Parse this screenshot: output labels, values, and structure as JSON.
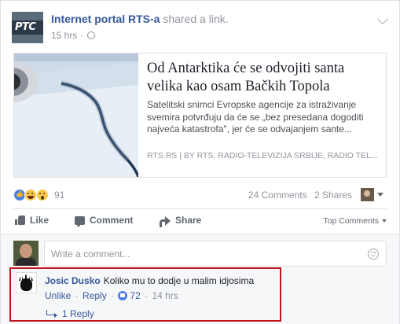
{
  "post": {
    "page_name": "Internet portal RTS-a",
    "shared_text": "shared a link.",
    "time": "15 hrs",
    "logo_text": "PTC"
  },
  "link": {
    "title": "Od Antarktika će se odvojiti santa velika kao osam Bačkih Topola",
    "description": "Satelitski snimci Evropske agencije za istraživanje svemira potvrđuju da će se „bez presedana dogoditi najveća katastrofa\", jer će se odvajanjem sante...",
    "source": "RTS.RS | BY RTS, RADIO-TELEVIZIJA SRBIJE, RADIO TEL..."
  },
  "stats": {
    "reaction_count": "91",
    "reactions": [
      "like",
      "haha",
      "wow"
    ],
    "comments": "24 Comments",
    "shares": "2 Shares"
  },
  "actions": {
    "like": "Like",
    "comment": "Comment",
    "share": "Share",
    "sort": "Top Comments"
  },
  "composer": {
    "placeholder": "Write a comment..."
  },
  "comment": {
    "author": "Josic Dusko",
    "text": "Koliko mu to dodje u malim idjosima",
    "unlike": "Unlike",
    "reply": "Reply",
    "like_count": "72",
    "time": "14 hrs",
    "replies": "1 Reply"
  },
  "colors": {
    "link_blue": "#365899",
    "highlight_red": "#c0131b",
    "like_blue": "#4e81e8"
  }
}
